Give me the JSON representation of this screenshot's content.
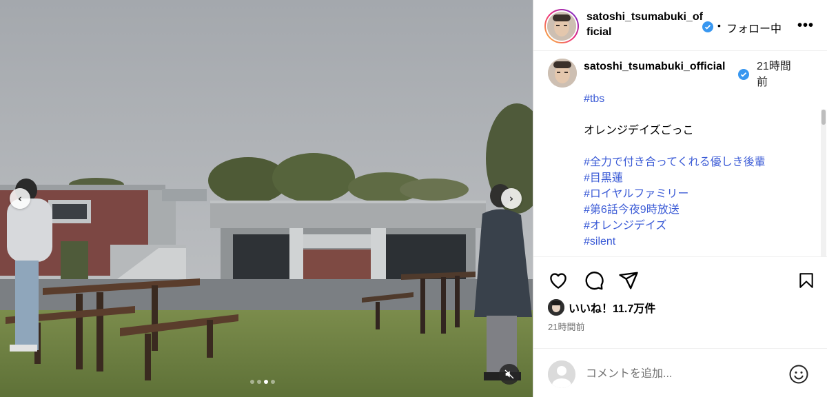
{
  "media": {
    "carousel": {
      "slide_count": 4,
      "active_index": 2
    },
    "prev_icon": "chevron-left-icon",
    "next_icon": "chevron-right-icon",
    "mute_icon": "speaker-muted-icon"
  },
  "header": {
    "username": "satoshi_tsumabuki_official",
    "verified": true,
    "separator": "•",
    "follow_status": "フォロー中",
    "more_icon": "more-horizontal-icon"
  },
  "caption": {
    "username": "satoshi_tsumabuki_official",
    "time": "21時間前",
    "lines": [
      {
        "text": "#tbs",
        "hashtag": true
      },
      {
        "text": "",
        "hashtag": false
      },
      {
        "text": "オレンジデイズごっこ",
        "hashtag": false
      },
      {
        "text": "",
        "hashtag": false
      },
      {
        "text": "#全力で付き合ってくれる優しき後輩",
        "hashtag": true
      },
      {
        "text": "#目黒蓮",
        "hashtag": true
      },
      {
        "text": "#ロイヤルファミリー",
        "hashtag": true
      },
      {
        "text": "#第6話今夜9時放送",
        "hashtag": true
      },
      {
        "text": "#オレンジデイズ",
        "hashtag": true
      },
      {
        "text": "#silent",
        "hashtag": true
      }
    ]
  },
  "actions": {
    "like_icon": "heart-icon",
    "comment_icon": "comment-bubble-icon",
    "share_icon": "paper-plane-icon",
    "save_icon": "bookmark-icon",
    "likes_text": "いいね！11.7万件",
    "time": "21時間前"
  },
  "comment": {
    "placeholder": "コメントを追加...",
    "emoji_icon": "smiley-icon"
  },
  "colors": {
    "hashtag": "#3b5bd6",
    "verified": "#3897f0",
    "border": "#dbdbdb"
  }
}
